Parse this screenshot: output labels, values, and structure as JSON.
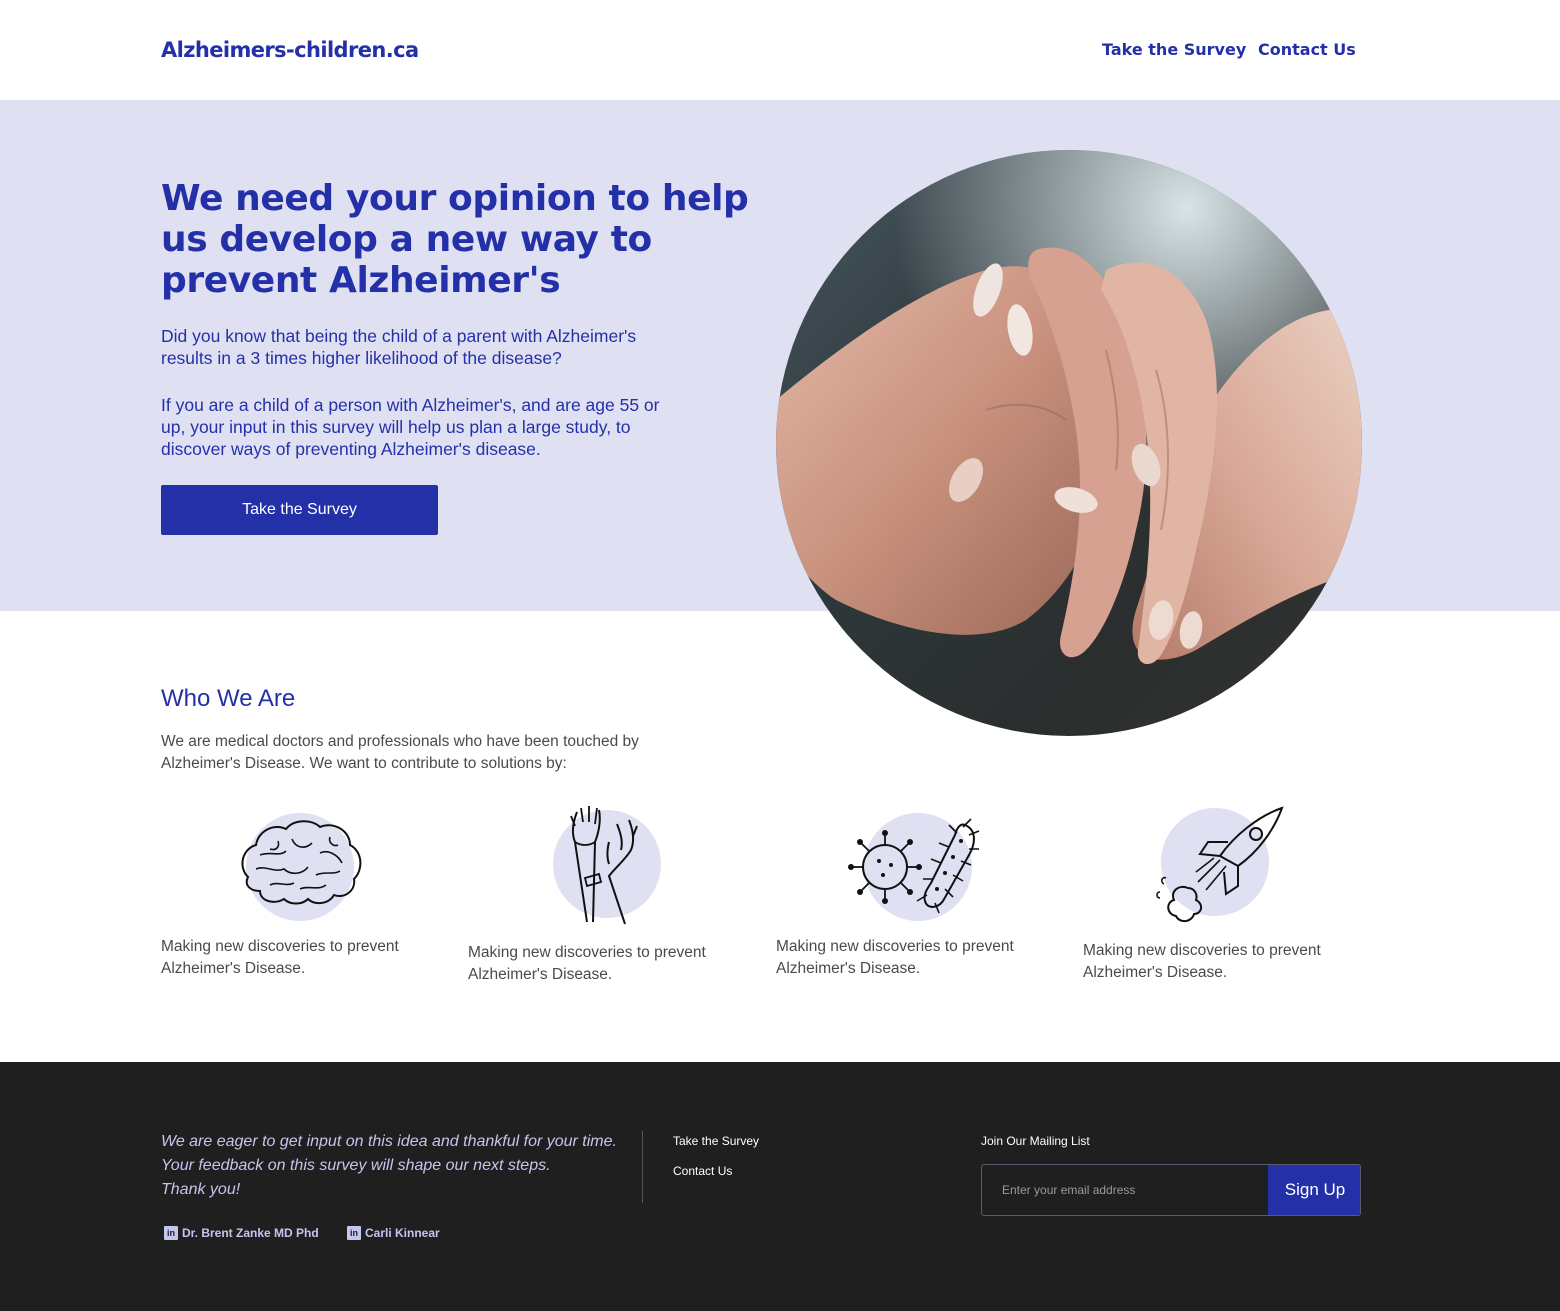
{
  "header": {
    "logo": "Alzheimers-children.ca",
    "nav": [
      {
        "label": "Take the Survey"
      },
      {
        "label": "Contact Us"
      }
    ]
  },
  "hero": {
    "title": "We need your opinion to help us develop a new way to prevent Alzheimer's",
    "paragraph1": "Did you know that being the child of a parent with Alzheimer's results in a 3 times higher likelihood of the disease?",
    "paragraph2": "If you are a child of a person with Alzheimer's, and are age 55 or up, your input in this survey will help us plan a large study, to discover ways of preventing Alzheimer's disease.",
    "button": "Take the Survey",
    "image": "elderly-hands-photo"
  },
  "who": {
    "title": "Who We Are",
    "text": "We are medical doctors and professionals who have been touched by Alzheimer's Disease. We want to contribute to solutions by:",
    "features": [
      {
        "icon": "brain-icon",
        "text": "Making new discoveries to prevent Alzheimer's Disease."
      },
      {
        "icon": "raised-hands-icon",
        "text": "Making new discoveries to prevent Alzheimer's Disease."
      },
      {
        "icon": "virus-bacteria-icon",
        "text": "Making new discoveries to prevent Alzheimer's Disease."
      },
      {
        "icon": "rocket-icon",
        "text": "Making new discoveries to prevent Alzheimer's Disease."
      }
    ]
  },
  "footer": {
    "quote_line1": "We are eager to get input on this idea and thankful for your time.",
    "quote_line2": "Your feedback on this survey will shape our next steps.",
    "quote_line3": "Thank you!",
    "links": [
      {
        "label": "Take the Survey"
      },
      {
        "label": "Contact Us"
      }
    ],
    "people": [
      {
        "name": "Dr. Brent Zanke MD Phd",
        "icon": "linkedin-icon"
      },
      {
        "name": "Carli Kinnear",
        "icon": "linkedin-icon"
      }
    ],
    "mailing_label": "Join Our Mailing List",
    "email_placeholder": "Enter your email address",
    "signup_button": "Sign Up"
  },
  "colors": {
    "brand": "#2430a8",
    "hero_bg": "#e0e0f3",
    "footer_bg": "#1f1f1f",
    "icon_circle": "#e0e0f3"
  }
}
